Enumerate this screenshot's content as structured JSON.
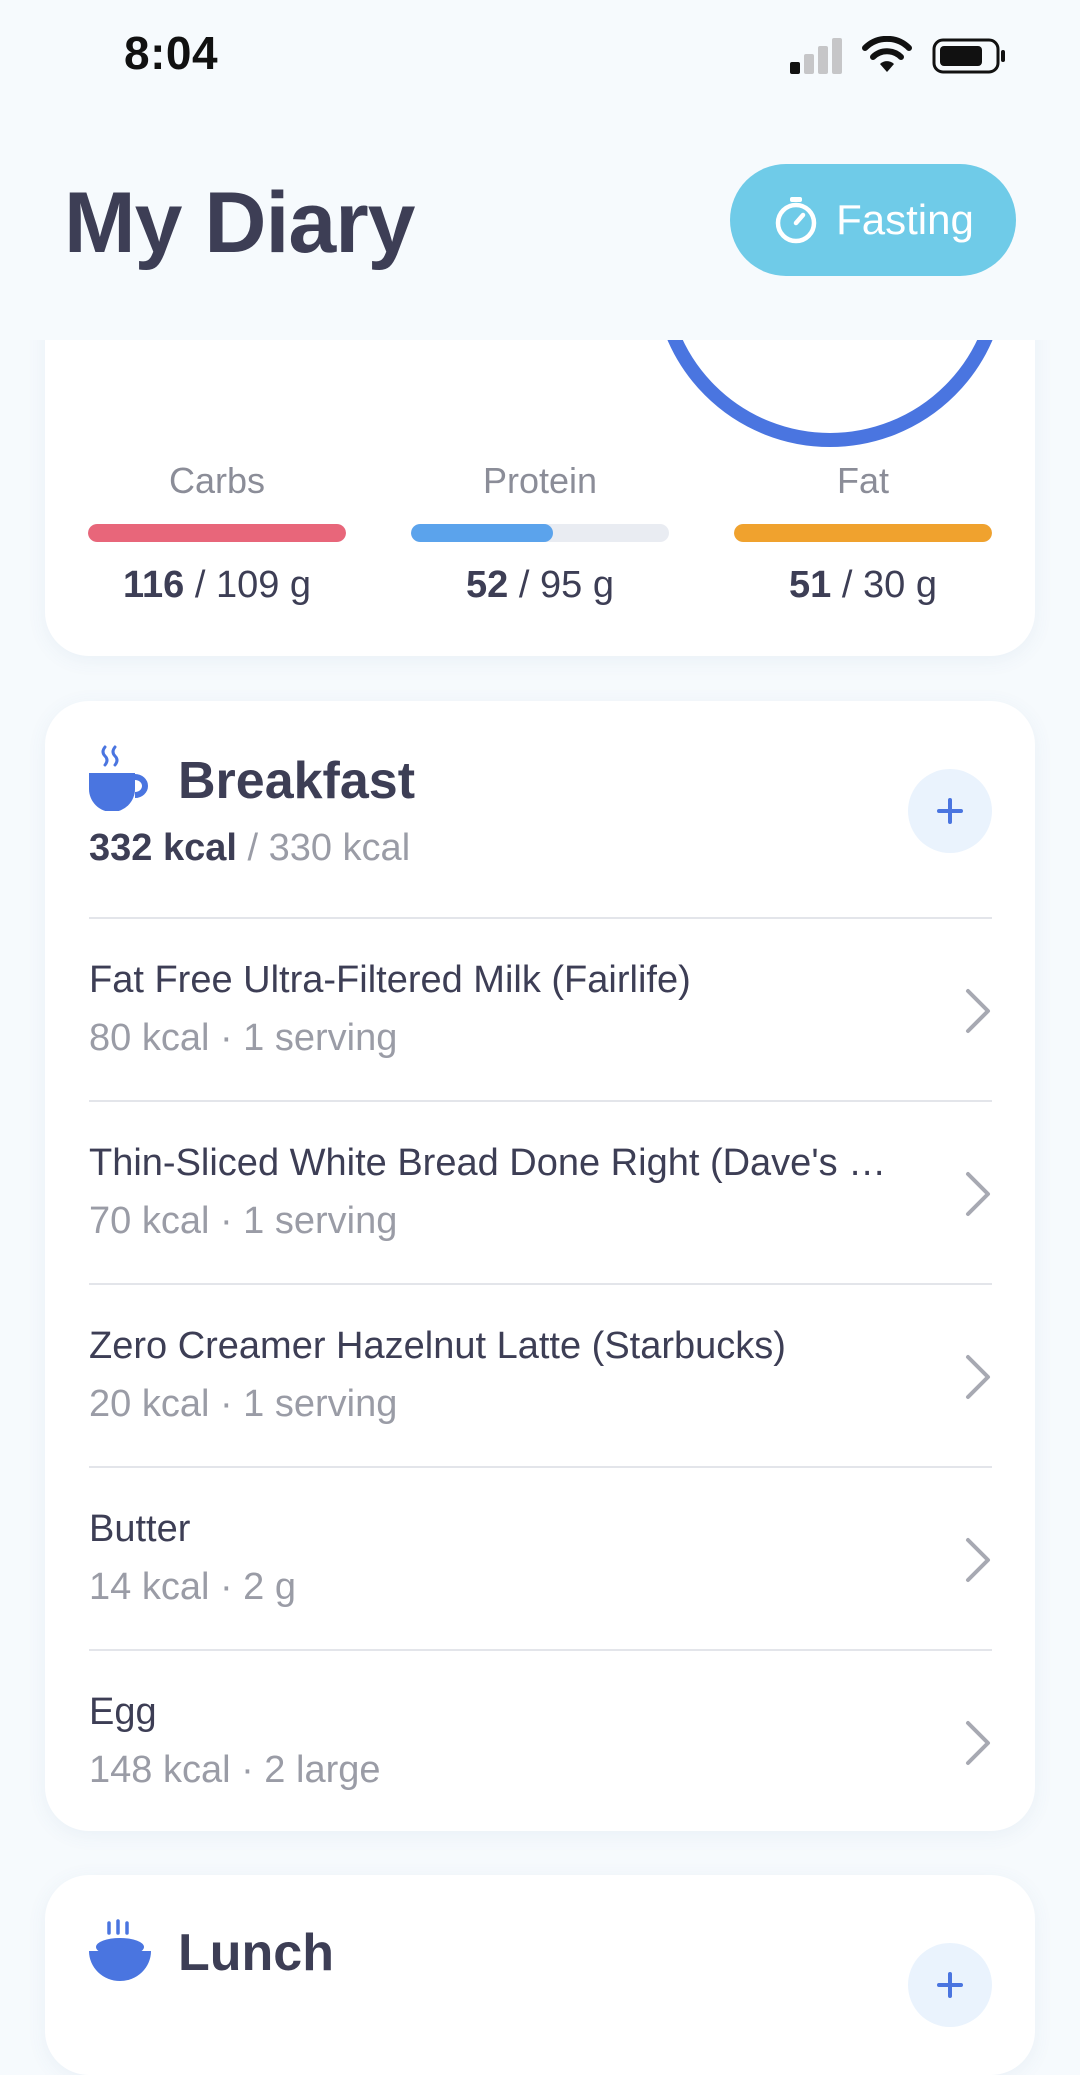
{
  "status_bar": {
    "time": "8:04"
  },
  "header": {
    "title": "My Diary",
    "fasting_label": "Fasting"
  },
  "macros": [
    {
      "label": "Carbs",
      "consumed": "116",
      "goal": "/ 109 g",
      "progress": 1.0,
      "color": "#e8667a"
    },
    {
      "label": "Protein",
      "consumed": "52",
      "goal": "/ 95 g",
      "progress": 0.55,
      "color": "#5ba3ec"
    },
    {
      "label": "Fat",
      "consumed": "51",
      "goal": "/ 30 g",
      "progress": 1.0,
      "color": "#f0a22e"
    }
  ],
  "breakfast": {
    "name": "Breakfast",
    "kcal_consumed": "332 kcal",
    "kcal_goal": " / 330 kcal",
    "items": [
      {
        "name": "Fat Free Ultra-Filtered Milk (Fairlife)",
        "detail": "80 kcal · 1 serving"
      },
      {
        "name": "Thin-Sliced White Bread Done Right (Dave's Killer Bread)",
        "detail": "70 kcal · 1 serving"
      },
      {
        "name": "Zero Creamer Hazelnut Latte (Starbucks)",
        "detail": "20 kcal · 1 serving"
      },
      {
        "name": "Butter",
        "detail": "14 kcal · 2 g"
      },
      {
        "name": "Egg",
        "detail": "148 kcal · 2 large"
      }
    ]
  },
  "lunch": {
    "name": "Lunch"
  },
  "colors": {
    "accent": "#4a75e0",
    "fasting": "#6fcbe8",
    "ring": "#4a75e0"
  },
  "icons": [
    "cellular-signal-icon",
    "wifi-icon",
    "battery-icon",
    "stopwatch-icon",
    "coffee-cup-icon",
    "plus-icon",
    "chevron-right-icon",
    "rice-bowl-icon"
  ]
}
